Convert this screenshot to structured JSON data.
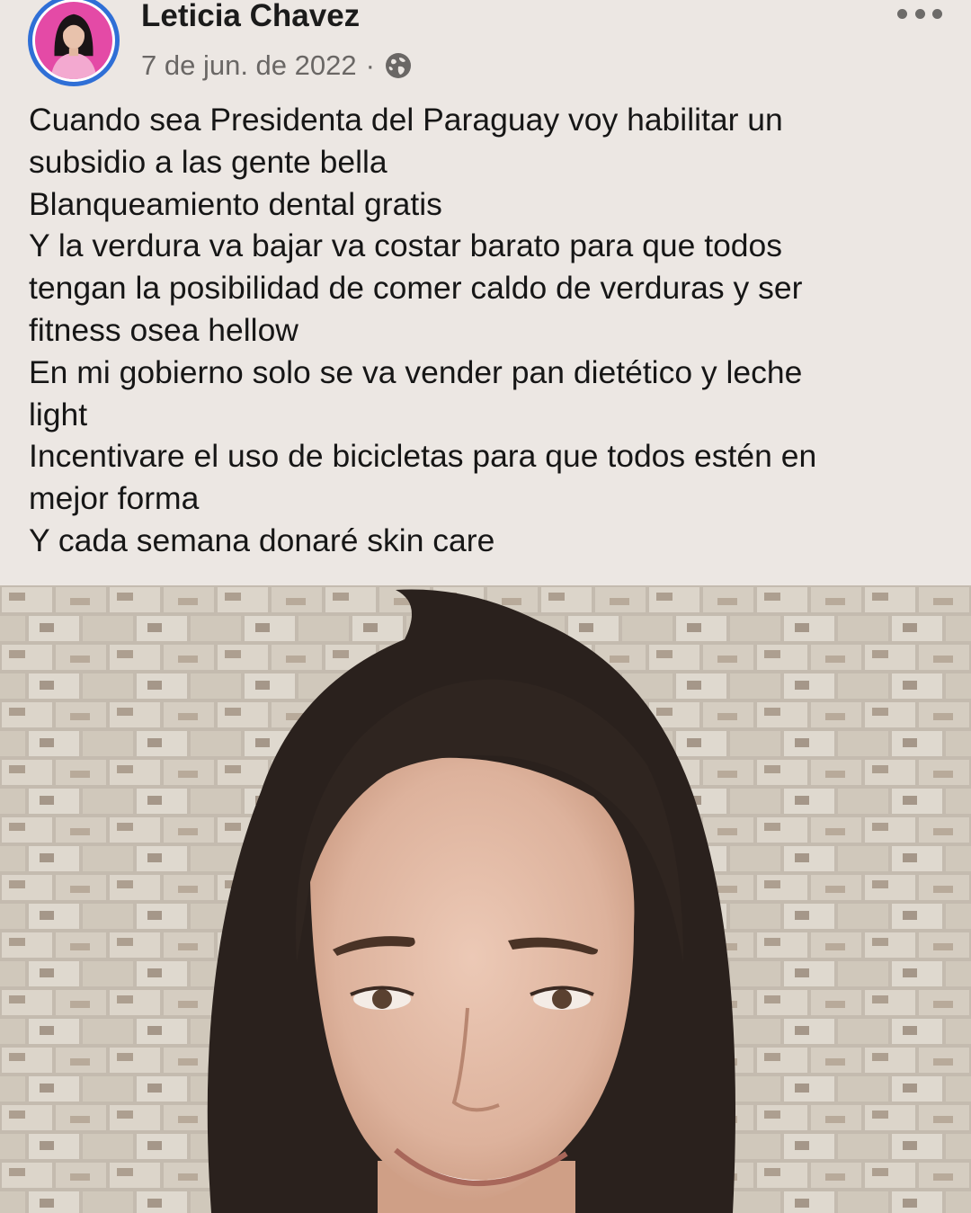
{
  "post": {
    "author_name": "Leticia Chavez",
    "date": "7 de jun. de 2022",
    "separator": "·",
    "audience_icon": "globe-icon",
    "more_icon": "more-dots-icon",
    "text_lines": [
      "Cuando sea Presidenta del Paraguay voy habilitar un",
      "subsidio a las gente bella",
      "Blanqueamiento dental gratis",
      "Y la verdura va bajar va costar barato para que todos",
      "tengan la posibilidad de comer caldo de verduras y ser",
      "fitness osea hellow",
      "En mi gobierno solo se va vender pan dietético y leche",
      "light",
      "Incentivare  el uso de bicicletas para que todos estén en",
      "mejor forma",
      "Y cada semana donaré skin care"
    ]
  },
  "colors": {
    "background": "#ece7e3",
    "avatar_ring": "#2f6fd6",
    "avatar_bg": "#e44aa6",
    "meta_text": "#6a6765"
  }
}
